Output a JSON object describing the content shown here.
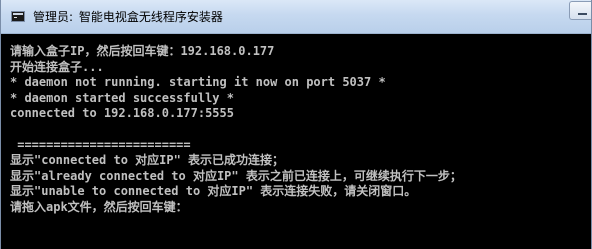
{
  "window": {
    "title_prefix": "管理员:",
    "title_name": "智能电视盒无线程序安装器",
    "app_icon": "cmd-icon",
    "minimize_icon": "minimize-icon"
  },
  "console": {
    "lines": [
      "请输入盒子IP，然后按回车键：192.168.0.177",
      "开始连接盒子...",
      "* daemon not running. starting it now on port 5037 *",
      "* daemon started successfully *",
      "connected to 192.168.0.177:5555",
      "",
      " ========================",
      "显示\"connected to 对应IP\" 表示已成功连接；",
      "显示\"already connected to 对应IP\" 表示之前已连接上，可继续执行下一步；",
      "显示\"unable to connected to 对应IP\" 表示连接失败，请关闭窗口。",
      "请拖入apk文件，然后按回车键："
    ],
    "colors": {
      "background": "#000000",
      "text": "#c0c0c0"
    }
  }
}
